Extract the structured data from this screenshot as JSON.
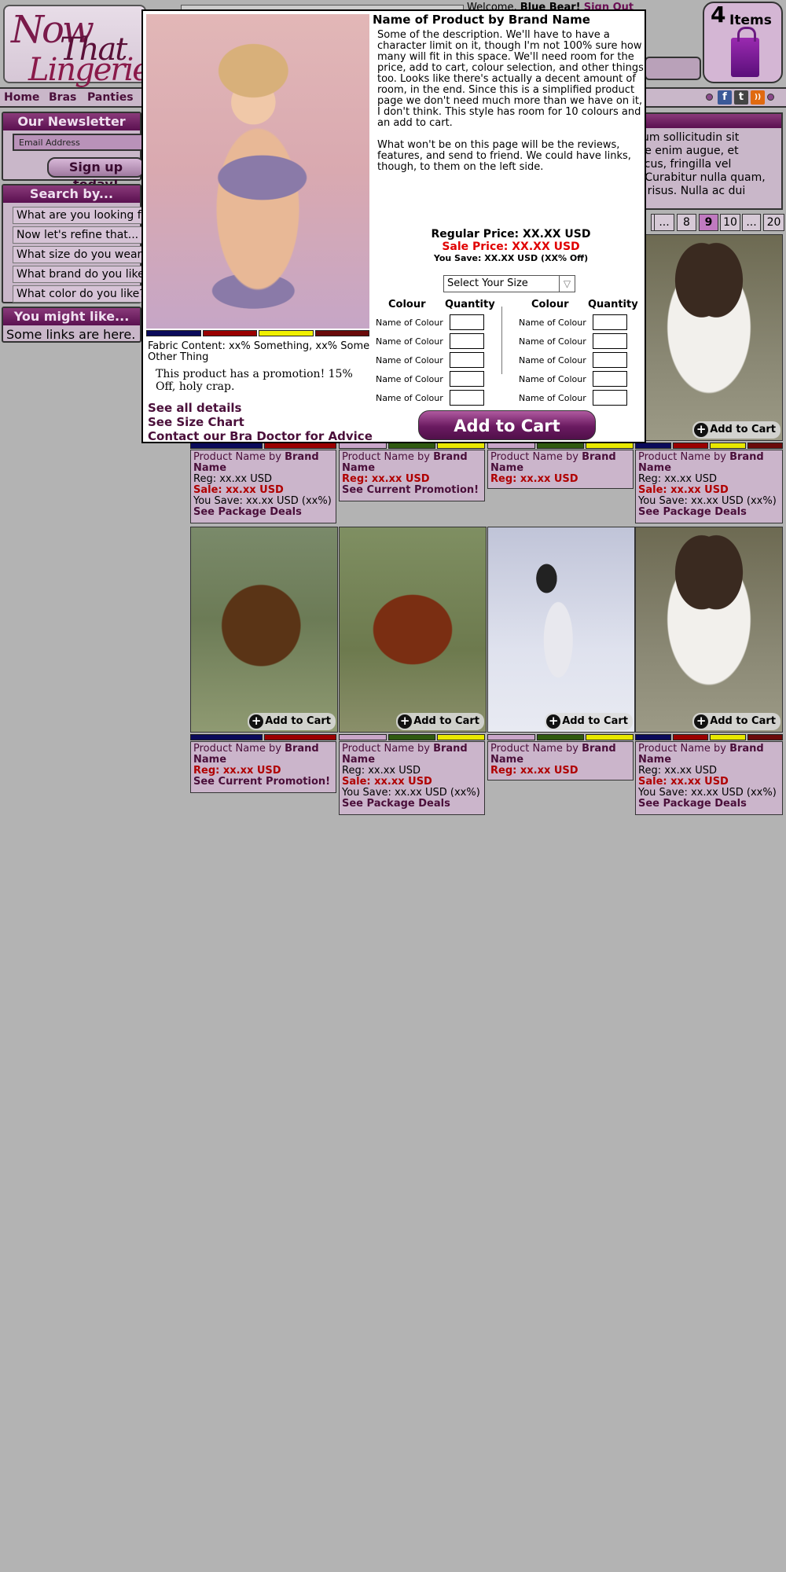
{
  "logo": {
    "line1": "Now",
    "line2": "That",
    "line3": "Lingerie"
  },
  "header": {
    "welcome": "Welcome,",
    "user": "Blue Bear!",
    "sign_out": "Sign Out"
  },
  "cart": {
    "count": "4",
    "items_label": "Items"
  },
  "nav": {
    "items": [
      "Home",
      "Bras",
      "Panties"
    ]
  },
  "social": [
    "f",
    "t",
    "rss"
  ],
  "newsletter": {
    "title": "Our Newsletter",
    "email_placeholder": "Email Address",
    "signup": "Sign up today!"
  },
  "search": {
    "title": "Search by...",
    "items": [
      "What are you looking for?",
      "Now let's refine that...",
      "What size do you wear?",
      "What brand do you like?",
      "What color do you like?"
    ]
  },
  "might_like": {
    "title": "You might like...",
    "text": "Some links are here."
  },
  "lorem_text": "...entum sollicitudin sit vitae enim augue, et n lacus, fringilla vel na. Curabitur nulla quam, ulla risus. Nulla ac dui",
  "lorem_lines": [
    "entum sollicitudin sit",
    "vitae enim augue, et",
    "n lacus, fringilla vel",
    "na. Curabitur nulla quam,",
    "ulla risus. Nulla ac dui"
  ],
  "pager": [
    "...",
    "8",
    "9",
    "10",
    "...",
    "20"
  ],
  "pager_current": "9",
  "add_to_cart": "Add to Cart",
  "products": [
    {
      "name": "Product Name by",
      "brand": "Brand Name",
      "reg": "Reg: xx.xx USD",
      "sale": "Sale: xx.xx USD",
      "save": "You Save: xx.xx USD (xx%)",
      "link": "See Package Deals"
    },
    {
      "name": "Product Name by",
      "brand": "Brand Name",
      "reg_sale": "Reg: xx.xx USD",
      "link": "See Current Promotion!"
    },
    {
      "name": "Product Name by",
      "brand": "Brand Name",
      "reg_sale": "Reg: xx.xx USD"
    },
    {
      "name": "Product Name by",
      "brand": "Brand Name",
      "reg": "Reg: xx.xx USD",
      "sale": "Sale: xx.xx USD",
      "save": "You Save: xx.xx USD (xx%)",
      "link": "See Package Deals"
    },
    {
      "name": "Product Name by",
      "brand": "Brand Name",
      "reg_sale": "Reg: xx.xx USD",
      "link": "See Current Promotion!"
    },
    {
      "name": "Product Name by",
      "brand": "Brand Name",
      "reg": "Reg: xx.xx USD",
      "sale": "Sale: xx.xx USD",
      "save": "You Save: xx.xx USD (xx%)",
      "link": "See Package Deals"
    },
    {
      "name": "Product Name by",
      "brand": "Brand Name",
      "reg_sale": "Reg: xx.xx USD"
    },
    {
      "name": "Product Name by",
      "brand": "Brand Name",
      "reg": "Reg: xx.xx USD",
      "sale": "Sale: xx.xx USD",
      "save": "You Save: xx.xx USD (xx%)",
      "link": "See Package Deals"
    }
  ],
  "colors": {
    "navy": "#0a0a5a",
    "red": "#9a0000",
    "yellow": "#f0f000",
    "maroon": "#6a0a0a",
    "lilac": "#c9a6c9",
    "green": "#2f5a10",
    "olive": "#c8c800",
    "accent": "#5a1050"
  },
  "modal": {
    "title": "Name of Product by Brand Name",
    "desc1": "Some of the description. We'll have to have a character limit on it, though I'm not 100% sure how many will fit in this space.  We'll need room for the price, add to cart, colour selection, and other things too.  Looks like there's actually a decent amount of room, in the end.  Since this is a simplified product page we don't need much more than we have on it, I don't think.  This style has room for 10 colours and an add to cart.",
    "desc2": "What won't be on this page will be the reviews, features, and send to friend. We could have links, though, to them on the left side.",
    "regular_price": "Regular Price: XX.XX USD",
    "sale_price": "Sale Price: XX.XX USD",
    "you_save": "You Save: XX.XX USD (XX% Off)",
    "size_select": "Select Your Size",
    "col_header": "Colour",
    "qty_header": "Quantity",
    "colour_name": "Name of Colour",
    "fabric": "Fabric Content: xx% Something, xx% Some Other Thing",
    "promo": "This product has a promotion!  15% Off, holy crap.",
    "links": [
      "See all details",
      "See Size Chart",
      "Contact our Bra Doctor for Advice"
    ],
    "add_to_cart": "Add to Cart"
  }
}
